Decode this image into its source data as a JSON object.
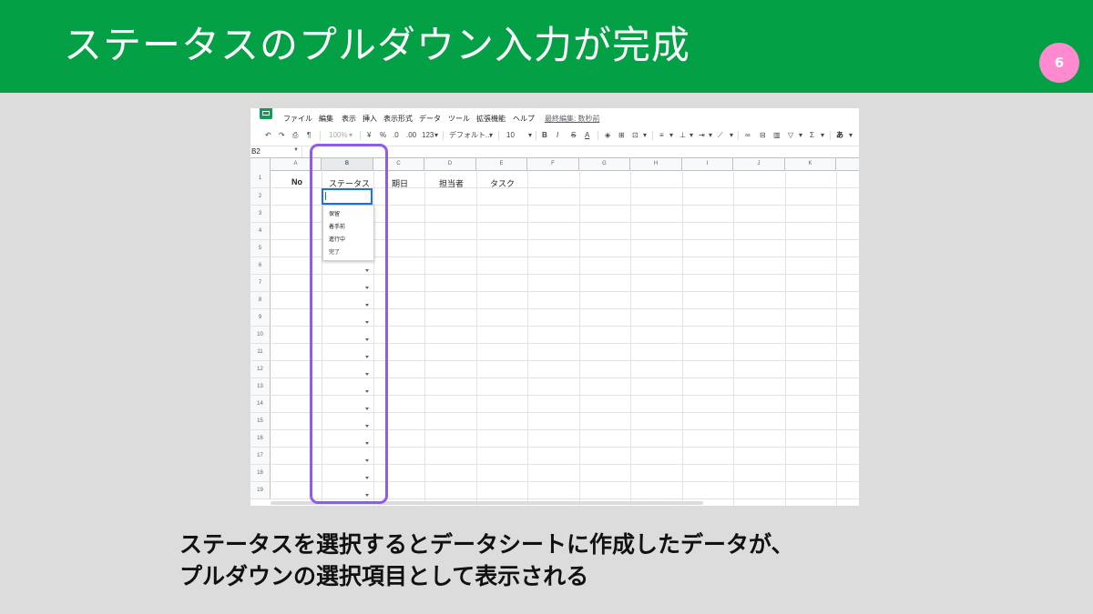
{
  "slide": {
    "title": "ステータスのプルダウン入力が完成",
    "page_number": "6",
    "caption_line1": "ステータスを選択するとデータシートに作成したデータが、",
    "caption_line2": "プルダウンの選択項目として表示される",
    "accent_color": "#8f5bea",
    "header_color": "#04a045",
    "badge_color": "#ff8ad0"
  },
  "sheet": {
    "logo_icon": "google-sheets-icon",
    "menu": [
      "ファイル",
      "編集",
      "表示",
      "挿入",
      "表示形式",
      "データ",
      "ツール",
      "拡張機能",
      "ヘルプ"
    ],
    "last_edit": "最終編集: 数秒前",
    "toolbar": {
      "zoom": "100%",
      "currency": "¥",
      "percent": "%",
      "decimal_decrease": ".0",
      "decimal_increase": ".00",
      "number_format": "123",
      "font": "デフォルト...",
      "font_size": "10",
      "bold": "B",
      "italic": "I",
      "strikethrough": "S",
      "text_color": "A",
      "input_tools": "あ"
    },
    "name_box": "B2",
    "columns": [
      "A",
      "B",
      "C",
      "D",
      "E",
      "F",
      "G",
      "H",
      "I",
      "J",
      "K"
    ],
    "active_column": "B",
    "rows": [
      "1",
      "2",
      "3",
      "4",
      "5",
      "6",
      "7",
      "8",
      "9",
      "10",
      "11",
      "12",
      "13",
      "14",
      "15",
      "16",
      "17",
      "18",
      "19"
    ],
    "header_cells": {
      "A1": "No",
      "B1": "ステータス",
      "C1": "期日",
      "D1": "担当者",
      "E1": "タスク"
    },
    "active_cell": "B2",
    "dropdown_options": [
      "保留",
      "着手前",
      "進行中",
      "完了"
    ]
  }
}
